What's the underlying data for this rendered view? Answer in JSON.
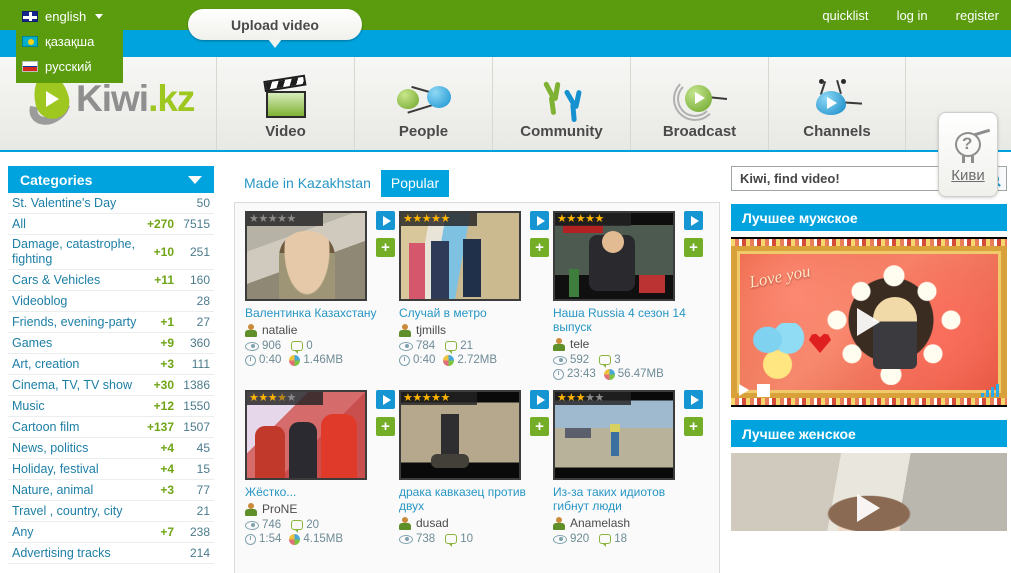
{
  "topbar": {
    "language_selected": "english",
    "languages": [
      {
        "label": "english",
        "flag": "uk-flag-icon"
      },
      {
        "label": "қазақша",
        "flag": "kz-flag-icon"
      },
      {
        "label": "русский",
        "flag": "ru-flag-icon"
      }
    ],
    "links": [
      "quicklist",
      "log in",
      "register"
    ],
    "upload_label": "Upload video",
    "bg_green": "#5a9c0e",
    "bg_blue": "#00a3dd"
  },
  "logo": {
    "part1": "Kiwi",
    "part2": ".kz"
  },
  "nav": [
    {
      "label": "Video",
      "icon": "clapperboard-icon"
    },
    {
      "label": "People",
      "icon": "people-icon"
    },
    {
      "label": "Community",
      "icon": "community-icon"
    },
    {
      "label": "Broadcast",
      "icon": "broadcast-icon"
    },
    {
      "label": "Channels",
      "icon": "channels-icon"
    }
  ],
  "kiwi_badge": {
    "label": "Киви",
    "icon": "kiwi-bird-question-icon"
  },
  "sidebar": {
    "title": "Categories",
    "items": [
      {
        "name": "St. Valentine's Day",
        "new": "",
        "total": "50"
      },
      {
        "name": "All",
        "new": "+270",
        "total": "7515"
      },
      {
        "name": "Damage, catastrophe, fighting",
        "new": "+10",
        "total": "251"
      },
      {
        "name": "Cars & Vehicles",
        "new": "+11",
        "total": "160"
      },
      {
        "name": "Videoblog",
        "new": "",
        "total": "28"
      },
      {
        "name": "Friends, evening-party",
        "new": "+1",
        "total": "27"
      },
      {
        "name": "Games",
        "new": "+9",
        "total": "360"
      },
      {
        "name": "Art, creation",
        "new": "+3",
        "total": "111"
      },
      {
        "name": "Cinema, TV, TV show",
        "new": "+30",
        "total": "1386"
      },
      {
        "name": "Music",
        "new": "+12",
        "total": "1550"
      },
      {
        "name": "Cartoon film",
        "new": "+137",
        "total": "1507"
      },
      {
        "name": "News, politics",
        "new": "+4",
        "total": "45"
      },
      {
        "name": "Holiday, festival",
        "new": "+4",
        "total": "15"
      },
      {
        "name": "Nature, animal",
        "new": "+3",
        "total": "77"
      },
      {
        "name": "Travel , country, city",
        "new": "",
        "total": "21"
      },
      {
        "name": "Any",
        "new": "+7",
        "total": "238"
      },
      {
        "name": "Advertising tracks",
        "new": "",
        "total": "214"
      }
    ]
  },
  "main": {
    "tabs": [
      {
        "label": "Made in Kazakhstan",
        "active": false
      },
      {
        "label": "Popular",
        "active": true
      }
    ],
    "videos": [
      {
        "title": "Валентинка Казахстану",
        "author": "natalie",
        "views": "906",
        "comments": "0",
        "duration": "0:40",
        "size": "1.46MB",
        "rating": 0,
        "thumb": "woman-webcam"
      },
      {
        "title": "Случай в метро",
        "author": "tjmills",
        "views": "784",
        "comments": "21",
        "duration": "0:40",
        "size": "2.72MB",
        "rating": 5,
        "thumb": "metro-doors"
      },
      {
        "title": "Наша Russia 4 сезон 14 выпуск",
        "author": "tele",
        "views": "592",
        "comments": "3",
        "duration": "23:43",
        "size": "56.47MB",
        "rating": 5,
        "thumb": "man-table"
      },
      {
        "title": "Жёстко...",
        "author": "ProNE",
        "views": "746",
        "comments": "20",
        "duration": "1:54",
        "size": "4.15MB",
        "rating": 3.5,
        "thumb": "kids-stage"
      },
      {
        "title": "драка кавказец против двух",
        "author": "dusad",
        "views": "738",
        "comments": "10",
        "duration": "",
        "size": "",
        "rating": 5,
        "thumb": "street-fight"
      },
      {
        "title": "Из-за таких идиотов гибнут люди",
        "author": "Anamelash",
        "views": "920",
        "comments": "18",
        "duration": "",
        "size": "",
        "rating": 3,
        "thumb": "road-walker"
      }
    ]
  },
  "right": {
    "search_value": "Kiwi, find video!",
    "search_icon": "magnifier-icon",
    "panels": [
      {
        "title": "Лучшее мужское",
        "media": "flower-frame-portrait"
      },
      {
        "title": "Лучшее женское",
        "media": "woman-closeup"
      }
    ]
  }
}
